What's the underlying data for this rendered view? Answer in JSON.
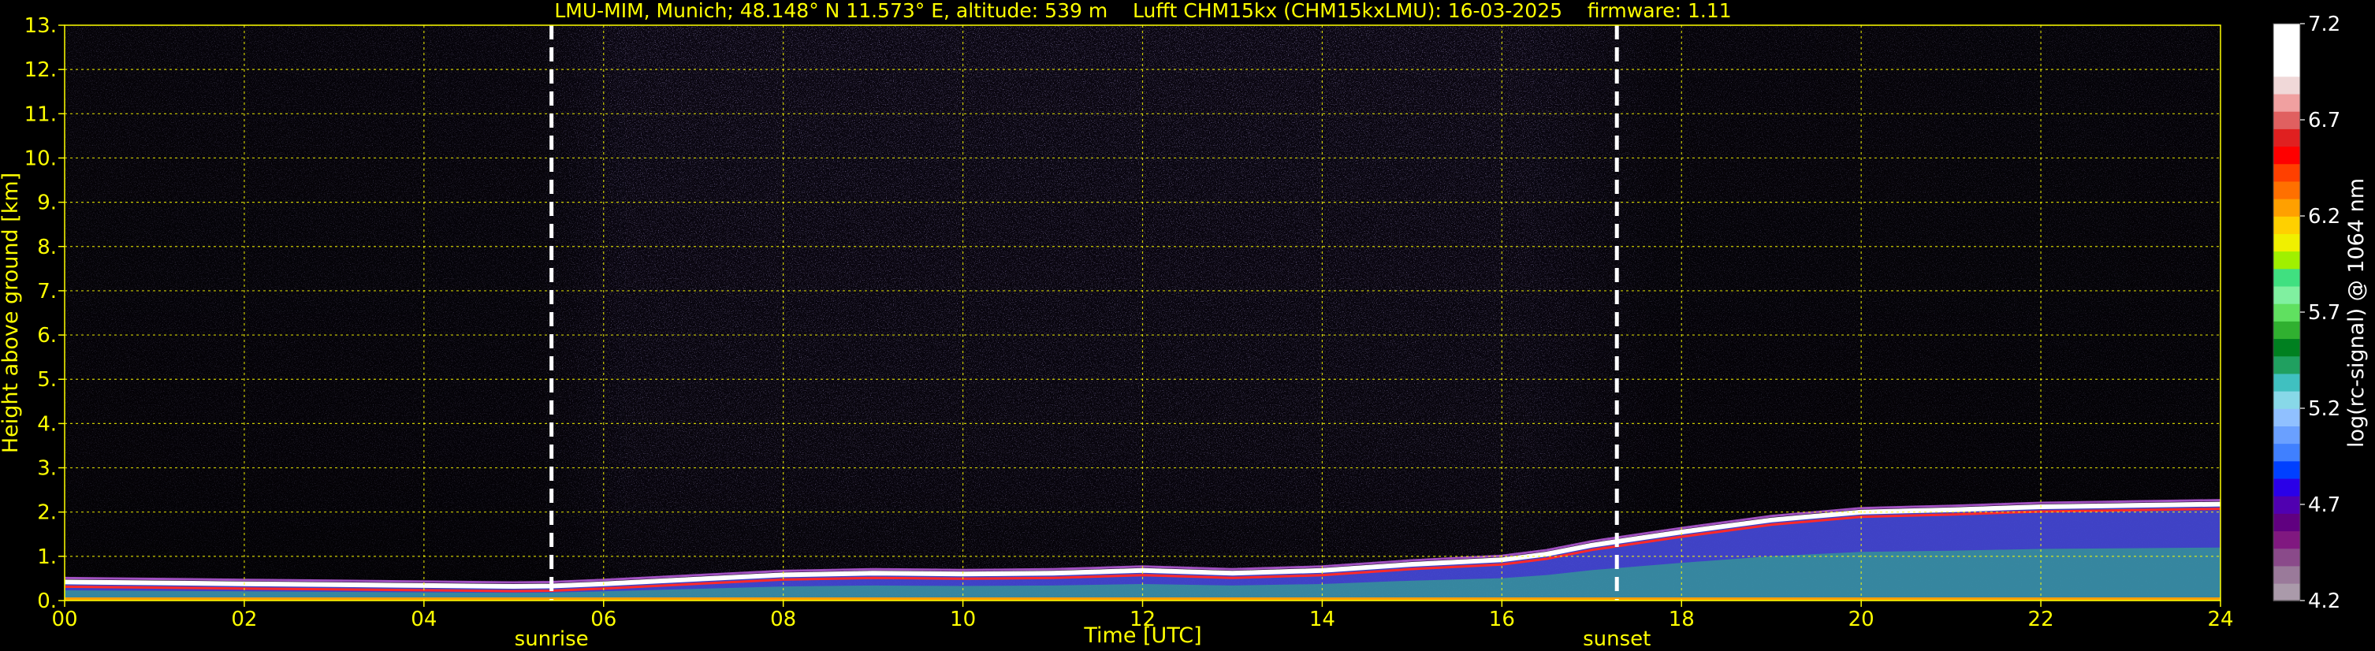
{
  "chart_data": {
    "type": "heatmap",
    "title": "LMU-MIM, Munich; 48.148° N 11.573° E, altitude: 539 m    Lufft CHM15kx (CHM15kxLMU): 16-03-2025    firmware: 1.11",
    "xlabel": "Time [UTC]",
    "ylabel": "Height above ground [km]",
    "xlim": [
      0,
      24
    ],
    "ylim": [
      0,
      13
    ],
    "x_ticks": [
      "00",
      "02",
      "04",
      "06",
      "08",
      "10",
      "12",
      "14",
      "16",
      "18",
      "20",
      "22",
      "24"
    ],
    "y_ticks": [
      "0.",
      "1.",
      "2.",
      "3.",
      "4.",
      "5.",
      "6.",
      "7.",
      "8.",
      "9.",
      "10.",
      "11.",
      "12.",
      "13."
    ],
    "grid": true,
    "markers": [
      {
        "label": "sunrise",
        "time": 5.42
      },
      {
        "label": "sunset",
        "time": 17.28
      }
    ],
    "colorbar": {
      "label": "log(rc-signal) @ 1064 nm",
      "range": [
        4.2,
        7.2
      ],
      "ticks": [
        "7.2",
        "6.7",
        "6.2",
        "5.7",
        "5.2",
        "4.7",
        "4.2"
      ],
      "colors": [
        "#aa9aaa",
        "#9a7a9a",
        "#8a4a8a",
        "#801880",
        "#600080",
        "#5000b0",
        "#2a00e8",
        "#0040ff",
        "#4080ff",
        "#6aa0ff",
        "#90c0ff",
        "#88d8e8",
        "#40c0c0",
        "#20a060",
        "#008020",
        "#30b030",
        "#60e060",
        "#80f0a0",
        "#40e080",
        "#a0f000",
        "#f0f000",
        "#ffd000",
        "#ffa000",
        "#ff7000",
        "#ff4000",
        "#ff0000",
        "#e02020",
        "#e06060",
        "#f0a0a0",
        "#f0d8d8",
        "#ffffff",
        "#ffffff",
        "#ffffff"
      ]
    },
    "boundary_layer_top_km": [
      [
        0,
        0.42
      ],
      [
        1,
        0.4
      ],
      [
        2,
        0.38
      ],
      [
        3,
        0.36
      ],
      [
        4,
        0.34
      ],
      [
        5,
        0.32
      ],
      [
        5.42,
        0.33
      ],
      [
        6,
        0.38
      ],
      [
        7,
        0.48
      ],
      [
        8,
        0.58
      ],
      [
        9,
        0.62
      ],
      [
        10,
        0.6
      ],
      [
        11,
        0.62
      ],
      [
        12,
        0.68
      ],
      [
        13,
        0.62
      ],
      [
        14,
        0.68
      ],
      [
        15,
        0.82
      ],
      [
        16,
        0.92
      ],
      [
        16.5,
        1.05
      ],
      [
        17,
        1.25
      ],
      [
        17.5,
        1.4
      ],
      [
        18,
        1.55
      ],
      [
        19,
        1.82
      ],
      [
        20,
        2.0
      ],
      [
        21,
        2.05
      ],
      [
        22,
        2.12
      ],
      [
        23,
        2.15
      ],
      [
        24,
        2.18
      ]
    ]
  }
}
